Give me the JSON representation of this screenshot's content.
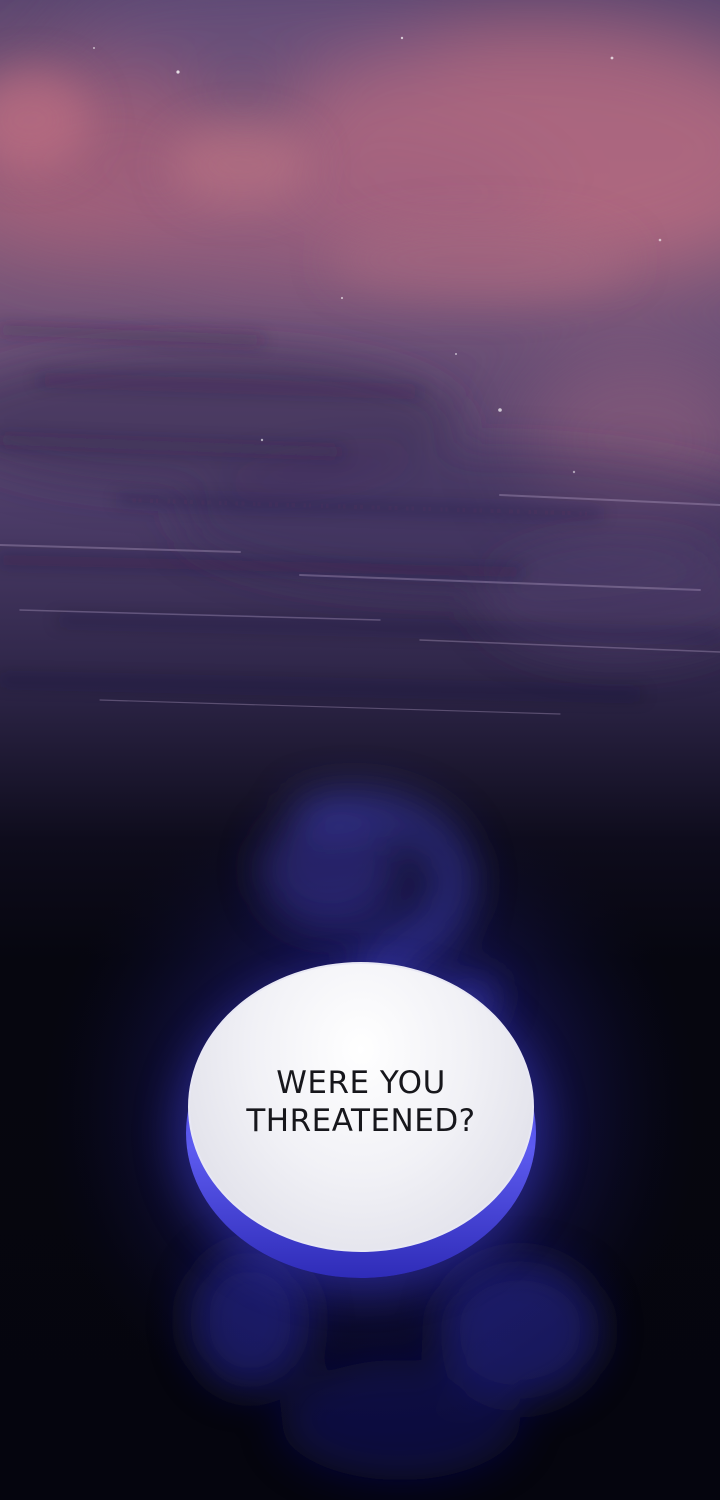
{
  "dialogue": {
    "speech_bubble_lines": [
      "WERE YOU",
      "THREATENED?"
    ]
  },
  "colors": {
    "sky_pink": "#8e5e7a",
    "sky_purple": "#4c3c68",
    "night": "#05050e",
    "aura_blue": "#3d3ad6",
    "bubble_fill": "#f1f1f6",
    "text": "#17171c"
  }
}
